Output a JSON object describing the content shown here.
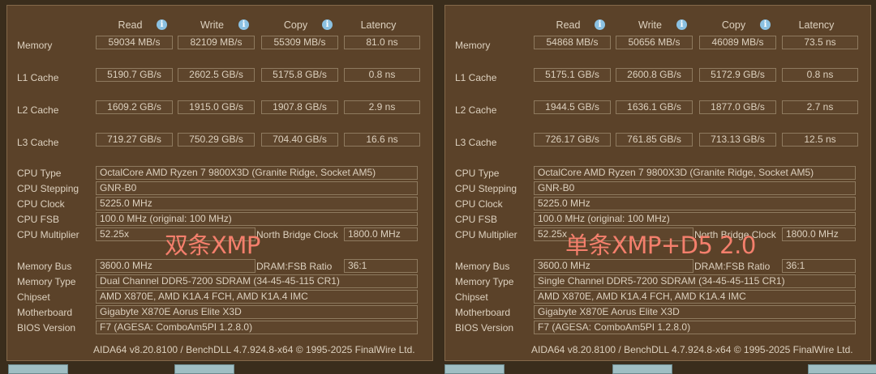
{
  "headers": {
    "read": "Read",
    "write": "Write",
    "copy": "Copy",
    "latency": "Latency"
  },
  "bench_labels": [
    "Memory",
    "L1 Cache",
    "L2 Cache",
    "L3 Cache"
  ],
  "info_labels": [
    "CPU Type",
    "CPU Stepping",
    "CPU Clock",
    "CPU FSB",
    "CPU Multiplier",
    "Memory Bus",
    "Memory Type",
    "Chipset",
    "Motherboard",
    "BIOS Version"
  ],
  "nb_clock_label": "North Bridge Clock",
  "dram_ratio_label": "DRAM:FSB Ratio",
  "footer": "AIDA64 v8.20.8100 / BenchDLL 4.7.924.8-x64 © 1995-2025 FinalWire Ltd.",
  "left": {
    "overlay": "双条XMP",
    "bench": [
      [
        "59034 MB/s",
        "82109 MB/s",
        "55309 MB/s",
        "81.0 ns"
      ],
      [
        "5190.7 GB/s",
        "2602.5 GB/s",
        "5175.8 GB/s",
        "0.8 ns"
      ],
      [
        "1609.2 GB/s",
        "1915.0 GB/s",
        "1907.8 GB/s",
        "2.9 ns"
      ],
      [
        "719.27 GB/s",
        "750.29 GB/s",
        "704.40 GB/s",
        "16.6 ns"
      ]
    ],
    "cpu_type": "OctalCore AMD Ryzen 7 9800X3D  (Granite Ridge, Socket AM5)",
    "cpu_stepping": "GNR-B0",
    "cpu_clock": "5225.0 MHz",
    "cpu_fsb": "100.0 MHz  (original: 100 MHz)",
    "cpu_multiplier": "52.25x",
    "nb_clock": "1800.0 MHz",
    "memory_bus": "3600.0 MHz",
    "dram_ratio": "36:1",
    "memory_type": "Dual Channel DDR5-7200 SDRAM  (34-45-45-115 CR1)",
    "chipset": "AMD X870E, AMD K1A.4 FCH, AMD K1A.4 IMC",
    "motherboard": "Gigabyte X870E Aorus Elite X3D",
    "bios": "F7  (AGESA: ComboAm5PI 1.2.8.0)"
  },
  "right": {
    "overlay": "单条XMP+D5 2.0",
    "bench": [
      [
        "54868 MB/s",
        "50656 MB/s",
        "46089 MB/s",
        "73.5 ns"
      ],
      [
        "5175.1 GB/s",
        "2600.8 GB/s",
        "5172.9 GB/s",
        "0.8 ns"
      ],
      [
        "1944.5 GB/s",
        "1636.1 GB/s",
        "1877.0 GB/s",
        "2.7 ns"
      ],
      [
        "726.17 GB/s",
        "761.85 GB/s",
        "713.13 GB/s",
        "12.5 ns"
      ]
    ],
    "cpu_type": "OctalCore AMD Ryzen 7 9800X3D  (Granite Ridge, Socket AM5)",
    "cpu_stepping": "GNR-B0",
    "cpu_clock": "5225.0 MHz",
    "cpu_fsb": "100.0 MHz  (original: 100 MHz)",
    "cpu_multiplier": "52.25x",
    "nb_clock": "1800.0 MHz",
    "memory_bus": "3600.0 MHz",
    "dram_ratio": "36:1",
    "memory_type": "Single Channel DDR5-7200 SDRAM  (34-45-45-115 CR1)",
    "chipset": "AMD X870E, AMD K1A.4 FCH, AMD K1A.4 IMC",
    "motherboard": "Gigabyte X870E Aorus Elite X3D",
    "bios": "F7  (AGESA: ComboAm5PI 1.2.8.0)"
  }
}
